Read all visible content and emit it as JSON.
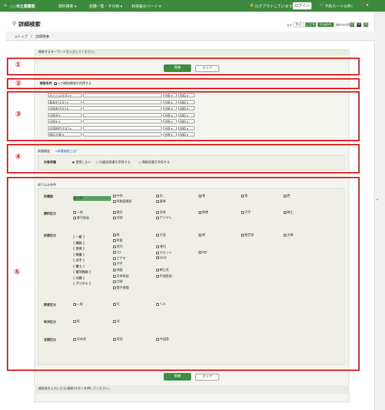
{
  "header": {
    "site_name": "○○市立図書館",
    "menu": [
      "資料検索 ▾",
      "各種一覧・その他 ▾",
      "利用者のページ ▾"
    ],
    "logout_status": "ログアウトしています",
    "login": "ログイン",
    "cart": "予約カート(0件)"
  },
  "page": {
    "title": "詳細検索",
    "breadcrumb": [
      "トップ",
      "詳細検索"
    ],
    "display_controls": {
      "font_label": "文字",
      "size_large": "大人",
      "size_child": "こども",
      "lang": "English",
      "color_label": "画面の色を変更",
      "zoom": [
        "小",
        "中",
        "大"
      ]
    },
    "info_message": "検索するキーワードを入力してください。",
    "search_button": "検索",
    "clear_button": "クリア",
    "footer_hint": "検索語を入力したら[検索]ボタンを押してください。"
  },
  "annotations": [
    "①",
    "②",
    "③",
    "④",
    "⑤"
  ],
  "conditions": {
    "label": "検索条件",
    "checkbox": "入力補助機能を利用する"
  },
  "fields": [
    {
      "field": "タイトル(全文)",
      "match": "中間",
      "op": "AND"
    },
    {
      "field": "著者名(全文)",
      "match": "中間",
      "op": "AND"
    },
    {
      "field": "出版者(全文)",
      "match": "中間",
      "op": "AND"
    },
    {
      "field": "出版地",
      "match": "中間",
      "op": "AND"
    },
    {
      "field": "出版年",
      "match": "中間",
      "op": "AND"
    },
    {
      "field": "内容細目(全文)",
      "match": "中間",
      "op": "AND"
    },
    {
      "field": "NDC分類",
      "match": "中間",
      "op": "AND"
    }
  ],
  "dictionary": {
    "title": "辞書機能",
    "link": "→辞書機能とは？",
    "label": "対象辞書",
    "options": [
      "使用しない",
      "同義語辞書を参照する",
      "典拠辞書を参照する"
    ]
  },
  "narrow": {
    "title": "絞り込み条件",
    "library_label": "所蔵館",
    "library_options": [
      "全部",
      "中央",
      "北",
      "東",
      "南",
      "西",
      "移動図書館",
      "書庫"
    ],
    "type_label": "資料区分",
    "type_options": [
      "一般",
      "雑誌",
      "音楽",
      "映像",
      "点字",
      "郷土",
      "複写絵画",
      "付録",
      "デジタル"
    ],
    "form_label": "形態区分",
    "form_groups": [
      "[ 一般 ]",
      "[ 雑誌 ]",
      "[ 音楽 ]",
      "[ 映像 ]",
      "[ 点字 ]",
      "[ 郷土 ]",
      "[ 複写絵画 ]",
      "[ 付録 ]",
      "[ デジタル ]"
    ],
    "form_options": [
      "冊",
      "大型",
      "紙",
      "紙芝居",
      "文庫",
      "新書",
      "逐刊",
      "増刊",
      "CD",
      "カセット",
      "MD",
      "ビデオ",
      "DVD",
      "点字",
      "地図",
      "郷土史",
      "日本絵画",
      "外国絵画",
      "付録",
      "電子書籍"
    ],
    "reader_label": "読者区分",
    "reader_options": [
      "一般",
      "児",
      "ＹＡ"
    ],
    "lang_type_label": "和洋区分",
    "lang_type_options": [
      "和",
      "洋"
    ],
    "language_label": "言語区分",
    "language_options": [
      "日本語",
      "英語",
      "中国語"
    ]
  }
}
